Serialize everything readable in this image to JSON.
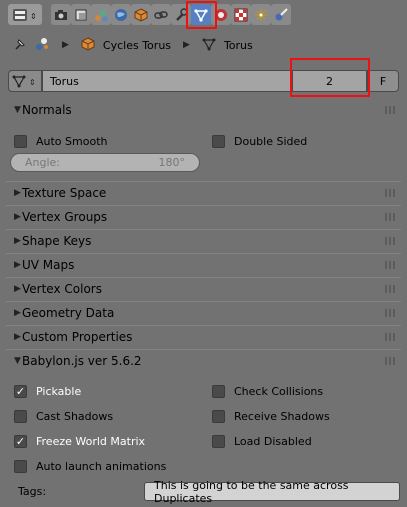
{
  "toolbar": {
    "buttons": [
      "editor-type",
      "render",
      "render-layers",
      "scene",
      "world",
      "object",
      "constraints",
      "modifiers",
      "data",
      "material",
      "texture",
      "particles",
      "physics"
    ],
    "selected": "data"
  },
  "breadcrumb": {
    "object_name": "Cycles Torus",
    "mesh_name": "Torus"
  },
  "datablock": {
    "name": "Torus",
    "users": "2",
    "fake_user": "F"
  },
  "panels": {
    "normals": {
      "title": "Normals",
      "auto_smooth": "Auto Smooth",
      "double_sided": "Double Sided",
      "angle_label": "Angle:",
      "angle_value": "180°"
    },
    "collapsed": [
      "Texture Space",
      "Vertex Groups",
      "Shape Keys",
      "UV Maps",
      "Vertex Colors",
      "Geometry Data",
      "Custom Properties"
    ],
    "babylon": {
      "title": "Babylon.js ver 5.6.2",
      "pickable": "Pickable",
      "check_collisions": "Check Collisions",
      "cast_shadows": "Cast Shadows",
      "receive_shadows": "Receive Shadows",
      "freeze_world_matrix": "Freeze World Matrix",
      "load_disabled": "Load Disabled",
      "auto_launch": "Auto launch animations",
      "tags_label": "Tags:",
      "tags_value": "This is going to be the same across Duplicates"
    }
  },
  "checks": {
    "pickable": true,
    "freeze_world_matrix": true
  },
  "colors": {
    "background": "#727272",
    "selected_tab": "#5680c2",
    "highlight": "#e11111"
  }
}
